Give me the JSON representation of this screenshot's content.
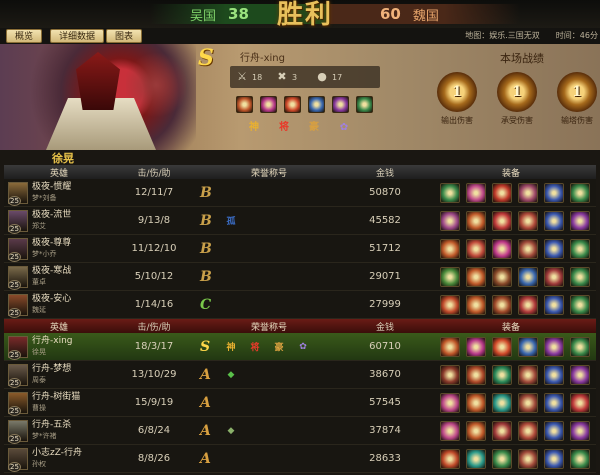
{
  "banner": {
    "left_nation": "吴国",
    "left_score": "38",
    "title": "胜利",
    "right_score": "60",
    "right_nation": "魏国"
  },
  "tabs": [
    "概览",
    "详细数据",
    "图表"
  ],
  "map_info": "地图：娱乐.三国无双　　时间：46分",
  "selected_player": {
    "grade": "S",
    "name": "行舟-xing",
    "hero": "徐晃",
    "stats": [
      {
        "icon": "swords-icon",
        "value": "18"
      },
      {
        "icon": "crossed-axes-icon",
        "value": "3"
      },
      {
        "icon": "coin-bag-icon",
        "value": "17"
      }
    ],
    "equip_colors": [
      "#c0572a",
      "#b83a8a",
      "#d04a2a",
      "#3a68b0",
      "#8a3aa0",
      "#3a8a4a"
    ],
    "honors": [
      {
        "text": "神",
        "color": "#e8b030"
      },
      {
        "text": "将",
        "color": "#e83a2a"
      },
      {
        "text": "豪",
        "color": "#d8a040"
      },
      {
        "text": "✿",
        "color": "#a080e0"
      }
    ]
  },
  "battle_record": {
    "title": "本场战绩",
    "medals": [
      {
        "num": "1",
        "label": "输出伤害"
      },
      {
        "num": "1",
        "label": "承受伤害"
      },
      {
        "num": "1",
        "label": "输塔伤害"
      }
    ]
  },
  "headers": {
    "hero": "英雄",
    "kda": "击/伤/助",
    "honor": "荣誉称号",
    "gold": "金钱",
    "equip": "装备"
  },
  "team1": [
    {
      "player": "极夜-惯耀",
      "hero": "梦*刘备",
      "level": "25",
      "kda": "12/11/7",
      "grade": "B",
      "honors": [],
      "gold": "50870",
      "avatar": "#8a6a3a",
      "equip": [
        "#3a8a4a",
        "#c04a8a",
        "#c03a2a",
        "#a04a6a",
        "#3a58b0",
        "#3a8a4a"
      ]
    },
    {
      "player": "极夜-流世",
      "hero": "郑艾",
      "level": "25",
      "kda": "9/13/8",
      "grade": "B",
      "honors": [
        {
          "text": "孤",
          "color": "#3a6ac0"
        }
      ],
      "gold": "45582",
      "avatar": "#6a4a6a",
      "equip": [
        "#a04a8a",
        "#c05a2a",
        "#c03a3a",
        "#b04a3a",
        "#3a58b0",
        "#8a3aa0"
      ]
    },
    {
      "player": "极夜-尊尊",
      "hero": "梦*小乔",
      "level": "25",
      "kda": "11/12/10",
      "grade": "B",
      "honors": [],
      "gold": "51712",
      "avatar": "#5a3a4a",
      "equip": [
        "#c05a2a",
        "#c04a3a",
        "#c03a8a",
        "#a04a3a",
        "#3a58b0",
        "#3a8a4a"
      ]
    },
    {
      "player": "极夜-寒战",
      "hero": "董卓",
      "level": "25",
      "kda": "5/10/12",
      "grade": "B",
      "honors": [],
      "gold": "29071",
      "avatar": "#7a6a4a",
      "equip": [
        "#4a8a3a",
        "#c05a2a",
        "#8a4a2a",
        "#3a68b0",
        "#a03a3a",
        "#3a8a4a"
      ]
    },
    {
      "player": "极夜-安心",
      "hero": "魏延",
      "level": "25",
      "kda": "1/14/16",
      "grade": "C",
      "honors": [],
      "gold": "27999",
      "avatar": "#8a4a2a",
      "equip": [
        "#c04a2a",
        "#c05a2a",
        "#a04a2a",
        "#b03a3a",
        "#3a58b0",
        "#3a8a4a"
      ]
    }
  ],
  "team2": [
    {
      "player": "行舟-xing",
      "hero": "徐晃",
      "level": "25",
      "kda": "18/3/17",
      "grade": "S",
      "highlight": true,
      "honors": [
        {
          "text": "神",
          "color": "#e8b030"
        },
        {
          "text": "将",
          "color": "#e83a2a"
        },
        {
          "text": "豪",
          "color": "#d8a040"
        },
        {
          "text": "✿",
          "color": "#a080e0"
        }
      ],
      "gold": "60710",
      "avatar": "#7a2a2a",
      "equip": [
        "#c0572a",
        "#b83a8a",
        "#d04a2a",
        "#3a68b0",
        "#8a3aa0",
        "#3a8a4a"
      ]
    },
    {
      "player": "行舟-梦想",
      "hero": "周泰",
      "level": "25",
      "kda": "13/10/29",
      "grade": "A",
      "honors": [
        {
          "text": "◆",
          "color": "#5ac04a"
        }
      ],
      "gold": "38670",
      "avatar": "#6a5a4a",
      "equip": [
        "#8a3a2a",
        "#b04a2a",
        "#2a8a5a",
        "#a04a3a",
        "#3a58b0",
        "#8a3aa0"
      ]
    },
    {
      "player": "行舟-树街猫",
      "hero": "曹操",
      "level": "25",
      "kda": "15/9/19",
      "grade": "A",
      "honors": [],
      "gold": "57545",
      "avatar": "#8a5a2a",
      "equip": [
        "#c04a8a",
        "#c05a2a",
        "#2a9a8a",
        "#a04a3a",
        "#3a58b0",
        "#c03a3a"
      ]
    },
    {
      "player": "行舟-五杀",
      "hero": "梦*许褚",
      "level": "25",
      "kda": "6/8/24",
      "grade": "A",
      "honors": [
        {
          "text": "◆",
          "color": "#8ab06a"
        }
      ],
      "gold": "37874",
      "avatar": "#7a7a6a",
      "equip": [
        "#c04a8a",
        "#c05a2a",
        "#a03a3a",
        "#b04a3a",
        "#3a58b0",
        "#8a3aa0"
      ]
    },
    {
      "player": "小志zZ-行舟",
      "hero": "孙权",
      "level": "25",
      "kda": "8/8/26",
      "grade": "A",
      "honors": [],
      "gold": "28633",
      "avatar": "#5a4a3a",
      "equip": [
        "#c04a2a",
        "#2a9a8a",
        "#3a8a4a",
        "#a04a3a",
        "#3a58b0",
        "#3a8a4a"
      ]
    }
  ]
}
